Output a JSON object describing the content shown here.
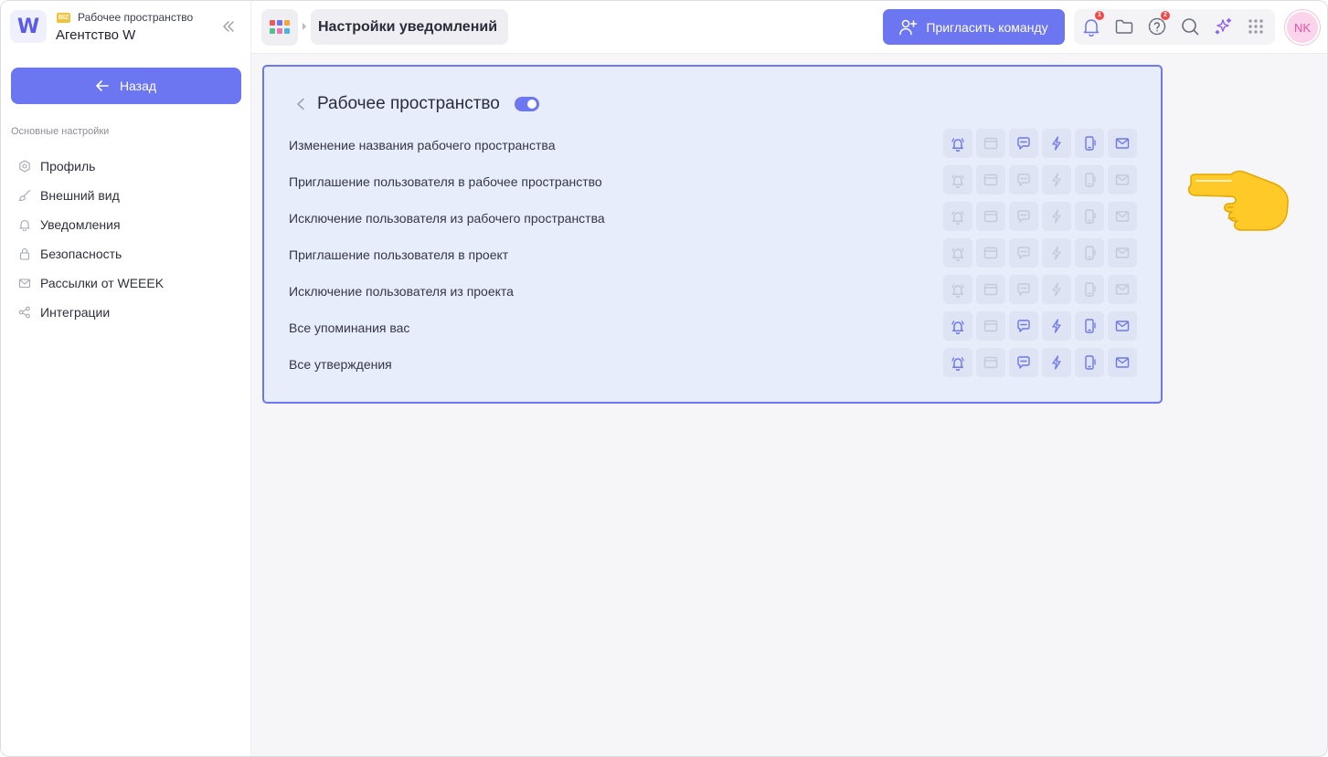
{
  "sidebar": {
    "workspace_badge": "BIZ",
    "workspace_label": "Рабочее пространство",
    "workspace_name": "Агентство W",
    "logo_letter": "W",
    "back_label": "Назад",
    "section_title": "Основные настройки",
    "items": [
      {
        "label": "Профиль",
        "icon": "settings-icon"
      },
      {
        "label": "Внешний вид",
        "icon": "brush-icon"
      },
      {
        "label": "Уведомления",
        "icon": "bell-icon"
      },
      {
        "label": "Безопасность",
        "icon": "lock-icon"
      },
      {
        "label": "Рассылки от WEEEK",
        "icon": "mail-icon"
      },
      {
        "label": "Интеграции",
        "icon": "integrations-icon"
      }
    ]
  },
  "header": {
    "title": "Настройки уведомлений",
    "invite_label": "Пригласить команду",
    "notifications_badge": "1",
    "help_badge": "2",
    "avatar_initials": "NK"
  },
  "panel": {
    "title": "Рабочее пространство",
    "enabled": true,
    "channels": [
      "bell-icon",
      "browser-icon",
      "chat-icon",
      "lightning-icon",
      "mobile-icon",
      "mail-icon"
    ],
    "rows": [
      {
        "label": "Изменение названия рабочего пространства",
        "states": [
          true,
          false,
          true,
          true,
          true,
          true
        ]
      },
      {
        "label": "Приглашение пользователя в рабочее пространство",
        "states": [
          false,
          false,
          false,
          false,
          false,
          false
        ]
      },
      {
        "label": "Исключение пользователя из рабочего пространства",
        "states": [
          false,
          false,
          false,
          false,
          false,
          false
        ]
      },
      {
        "label": "Приглашение пользователя в проект",
        "states": [
          false,
          false,
          false,
          false,
          false,
          false
        ]
      },
      {
        "label": "Исключение пользователя из проекта",
        "states": [
          false,
          false,
          false,
          false,
          false,
          false
        ]
      },
      {
        "label": "Все упоминания вас",
        "states": [
          true,
          false,
          true,
          true,
          true,
          true
        ]
      },
      {
        "label": "Все утверждения",
        "states": [
          true,
          false,
          true,
          true,
          true,
          true
        ]
      }
    ]
  },
  "colors": {
    "accent": "#6c76f0",
    "panel_bg": "#e8edfc",
    "channel_off": "#c4c9d8",
    "badge": "#ee4a4a"
  }
}
